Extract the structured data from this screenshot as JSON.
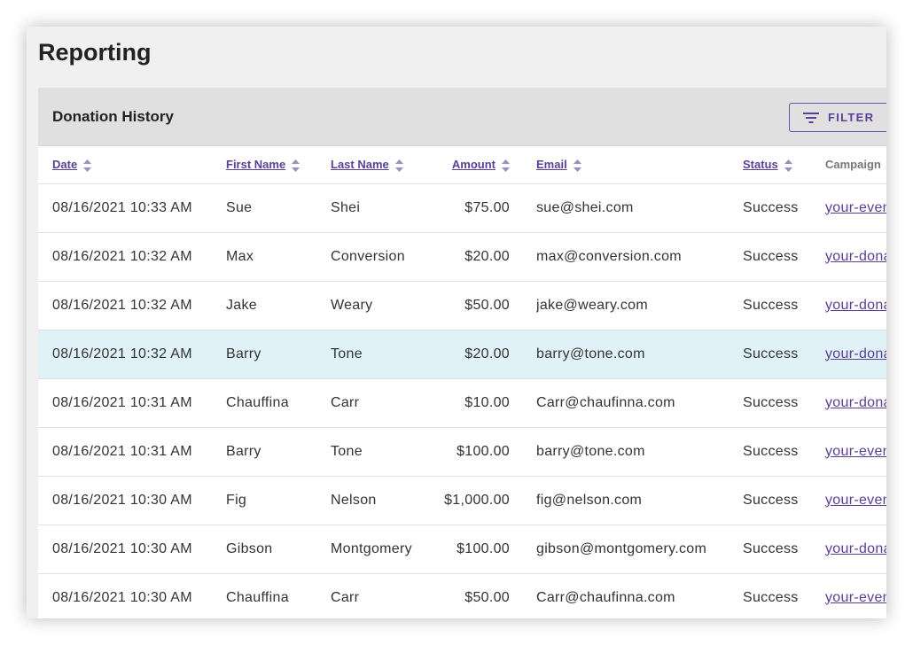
{
  "page": {
    "title": "Reporting"
  },
  "card": {
    "title": "Donation History",
    "filter_label": "FILTER"
  },
  "colors": {
    "accent": "#5a3f96",
    "highlight_row": "#e1f1f8",
    "header_bg": "#e0e0e0"
  },
  "table": {
    "columns": [
      "Date",
      "First Name",
      "Last Name",
      "Amount",
      "Email",
      "Status",
      "Campaign"
    ],
    "highlighted_row_index": 3,
    "rows": [
      {
        "date": "08/16/2021 10:33 AM",
        "first": "Sue",
        "last": "Shei",
        "amount": "$75.00",
        "email": "sue@shei.com",
        "status": "Success",
        "campaign": "your-even"
      },
      {
        "date": "08/16/2021 10:32 AM",
        "first": "Max",
        "last": "Conversion",
        "amount": "$20.00",
        "email": "max@conversion.com",
        "status": "Success",
        "campaign": "your-dona"
      },
      {
        "date": "08/16/2021 10:32 AM",
        "first": "Jake",
        "last": "Weary",
        "amount": "$50.00",
        "email": "jake@weary.com",
        "status": "Success",
        "campaign": "your-dona"
      },
      {
        "date": "08/16/2021 10:32 AM",
        "first": "Barry",
        "last": "Tone",
        "amount": "$20.00",
        "email": "barry@tone.com",
        "status": "Success",
        "campaign": "your-dona"
      },
      {
        "date": "08/16/2021 10:31 AM",
        "first": "Chauffina",
        "last": "Carr",
        "amount": "$10.00",
        "email": "Carr@chaufinna.com",
        "status": "Success",
        "campaign": "your-dona"
      },
      {
        "date": "08/16/2021 10:31 AM",
        "first": "Barry",
        "last": "Tone",
        "amount": "$100.00",
        "email": "barry@tone.com",
        "status": "Success",
        "campaign": "your-even"
      },
      {
        "date": "08/16/2021 10:30 AM",
        "first": "Fig",
        "last": "Nelson",
        "amount": "$1,000.00",
        "email": "fig@nelson.com",
        "status": "Success",
        "campaign": "your-even"
      },
      {
        "date": "08/16/2021 10:30 AM",
        "first": "Gibson",
        "last": "Montgomery",
        "amount": "$100.00",
        "email": "gibson@montgomery.com",
        "status": "Success",
        "campaign": "your-dona"
      },
      {
        "date": "08/16/2021 10:30 AM",
        "first": "Chauffina",
        "last": "Carr",
        "amount": "$50.00",
        "email": "Carr@chaufinna.com",
        "status": "Success",
        "campaign": "your-even"
      }
    ]
  }
}
